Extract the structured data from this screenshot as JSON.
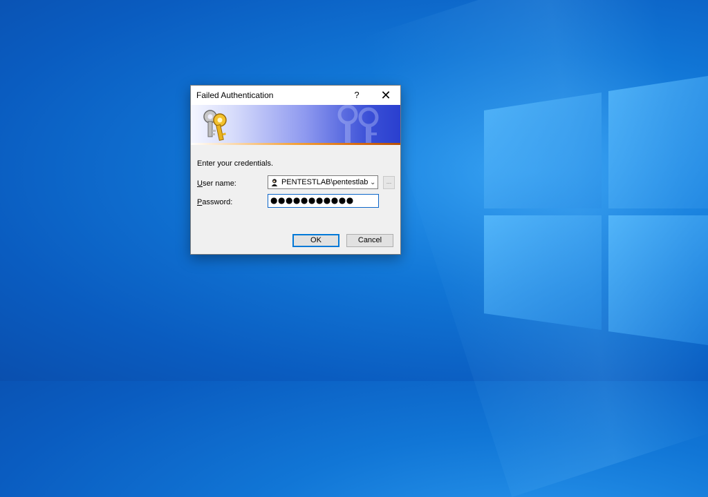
{
  "dialog": {
    "title": "Failed Authentication",
    "help_label": "?",
    "close_label": "✕",
    "prompt": "Enter your credentials.",
    "username_label_u": "U",
    "username_label_rest": "ser name:",
    "password_label_p": "P",
    "password_label_rest": "assword:",
    "username_value": "PENTESTLAB\\pentestlab",
    "browse_label": "...",
    "password_mask": "●●●●●●●●●●●",
    "ok_label": "OK",
    "cancel_label": "Cancel"
  },
  "colors": {
    "desktop": "#1176d6",
    "banner_accent": "#3a4fd6",
    "focus_border": "#0078d7"
  }
}
